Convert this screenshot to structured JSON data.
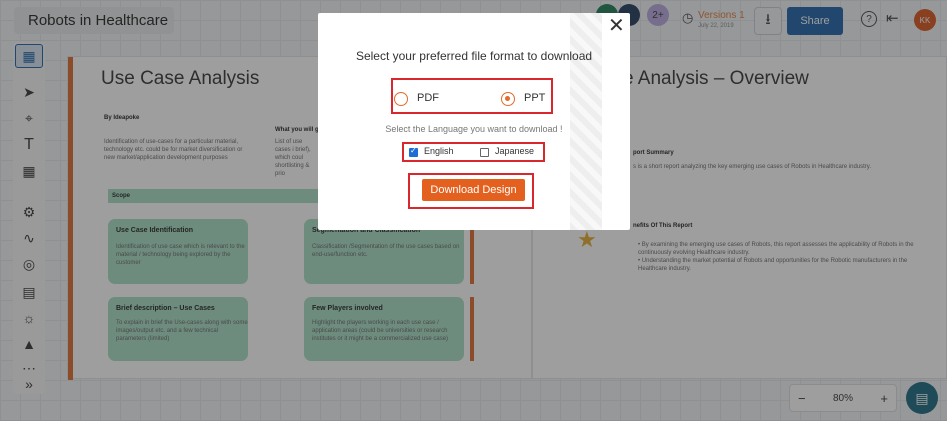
{
  "header": {
    "app_title": "Robots in Healthcare",
    "collaborator_initials": [
      "",
      "",
      "2+"
    ],
    "versions_label": "Versions",
    "versions_count": "1",
    "versions_date": "July 22, 2019",
    "share_label": "Share",
    "user_initials": "KK",
    "colors": {
      "share": "#1d62a8",
      "accent": "#e06b2b"
    }
  },
  "toolbar": {
    "icons": [
      "layout-icon",
      "pointer-icon",
      "crop-icon",
      "text-icon",
      "grid-icon",
      "robot-icon",
      "pulse-icon",
      "mic-icon",
      "chart-icon",
      "bulb-icon",
      "flask-icon",
      "more-icon",
      "expand-icon"
    ]
  },
  "slide_left": {
    "title": "Use Case Analysis",
    "by_label": "By Ideapoke",
    "intro_text": "Identification of use-cases for a particular material, technology etc. could be for market diversification or new market/application development purposes",
    "what_label": "What you will g",
    "what_text": "List of use cases i brief), which coul shortlisting & prio",
    "scope_label": "Scope",
    "cards": [
      {
        "title": "Use Case Identification",
        "text": "Identification of use case which is relevant to the material / technology being explored by the customer"
      },
      {
        "title": "Segmentation and Classification",
        "text": "Classification /Segmentation of the use cases based on end-use/function etc."
      },
      {
        "title": "Brief description – Use Cases",
        "text": "To explain in brief the Use-cases along with some images/output etc. and a few technical parameters (limited)"
      },
      {
        "title": "Few Players involved",
        "text": "Highlight the players working in each use case / application areas (could be universities or research institutes or it might be a commercialized use case)"
      }
    ]
  },
  "slide_right": {
    "title": "e Analysis – Overview",
    "summary_title": "port Summary",
    "summary_text": "s is a short report analyzing the key emerging use cases of Robots in Healthcare industry.",
    "benefits_title": "nefits Of This Report",
    "benefits": [
      "By examining the emerging use cases of Robots, this report assesses the applicability of Robots in the continuously evolving Healthcare industry.",
      "Understanding the market potential of Robots and opportunities for the Robotic manufacturers in the Healthcare industry."
    ]
  },
  "zoom": {
    "minus": "−",
    "value": "80%",
    "plus": "+"
  },
  "modal": {
    "title": "Select your preferred file format to download",
    "formats": [
      {
        "label": "PDF",
        "selected": false
      },
      {
        "label": "PPT",
        "selected": true
      }
    ],
    "language_prompt": "Select the Language you want to download !",
    "languages": [
      {
        "label": "English",
        "checked": true
      },
      {
        "label": "Japanese",
        "checked": false
      }
    ],
    "download_label": "Download Design",
    "close_symbol": "✕"
  }
}
